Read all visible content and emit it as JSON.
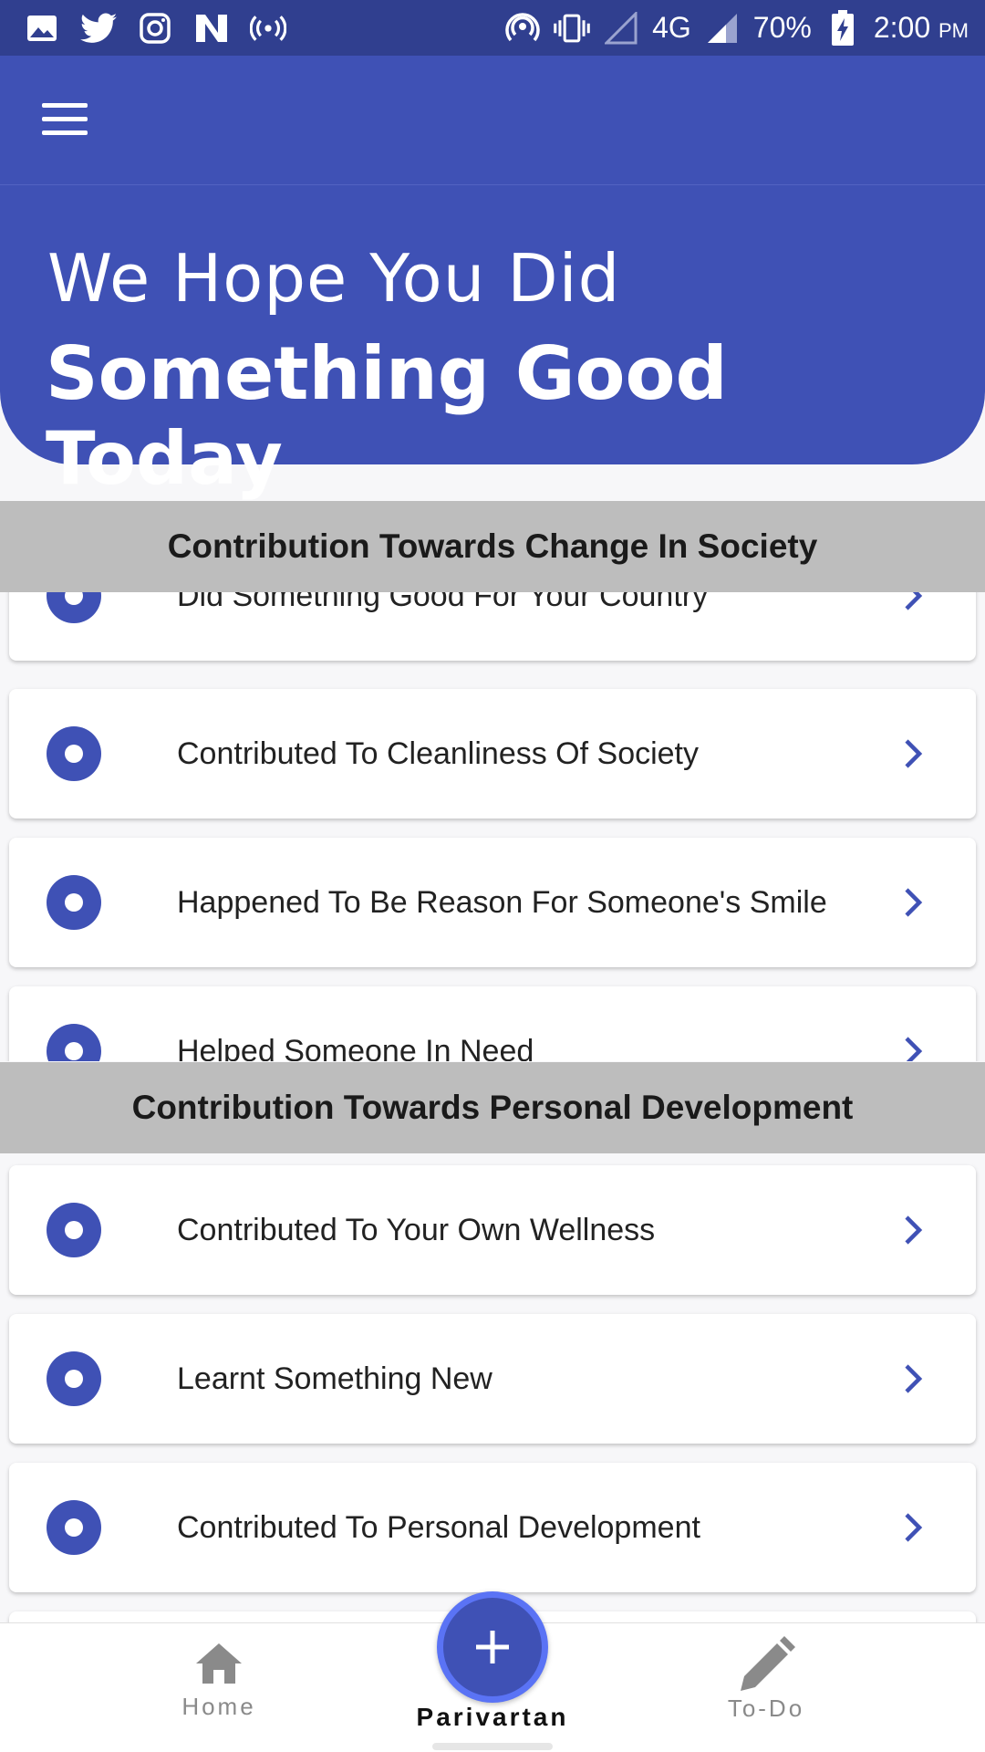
{
  "status_bar": {
    "icons": [
      "image-icon",
      "twitter-icon",
      "instagram-icon",
      "n-app-icon",
      "hotspot-icon",
      "nfc-icon",
      "vibrate-icon",
      "signal-empty-icon",
      "signal-icon",
      "battery-charging-icon"
    ],
    "network": "4G",
    "battery": "70%",
    "time": "2:00",
    "ampm": "PM"
  },
  "appbar": {
    "menu_icon": "hamburger-menu-icon"
  },
  "hero": {
    "line1": "We Hope You Did",
    "line2": "Something Good Today"
  },
  "sections": [
    {
      "title": "Contribution Towards Change In Society",
      "items": [
        "Did Something Good For Your Country",
        "Contributed To Cleanliness Of Society",
        "Happened To Be Reason For Someone's Smile",
        "Helped Someone In Need"
      ]
    },
    {
      "title": "Contribution Towards Personal Development",
      "items": [
        "Contributed To Your Own Wellness",
        "Learnt Something New",
        "Contributed To Personal Development"
      ]
    }
  ],
  "bottom_nav": {
    "home": "Home",
    "center": "Parivartan",
    "todo": "To-Do"
  },
  "colors": {
    "primary": "#3f51b5",
    "status_bar": "#303f8f",
    "section_header_bg": "#bdbdbd",
    "fab_ring": "#5a73f5"
  }
}
